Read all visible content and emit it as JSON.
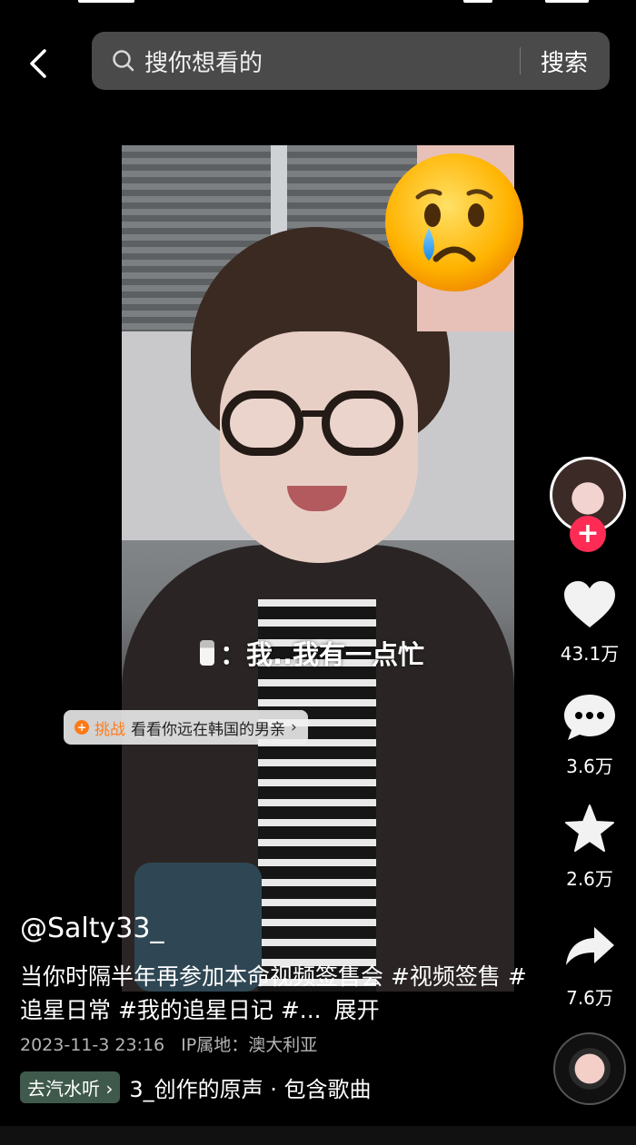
{
  "search": {
    "placeholder": "搜你想看的",
    "button": "搜索"
  },
  "video": {
    "caption": "：我..我有一点忙",
    "challenge_tag": "挑战",
    "challenge_text": "看看你远在韩国的男亲",
    "emoji": "crying-face"
  },
  "actions": {
    "likes": "43.1万",
    "comments": "3.6万",
    "favorites": "2.6万",
    "shares": "7.6万"
  },
  "post": {
    "author": "@Salty33_",
    "description": "当你时隔半年再参加本命视频签售会 #视频签售 #追星日常 #我的追星日记 #...",
    "expand": "展开",
    "date": "2023-11-3 23:16",
    "ip_location": "IP属地：澳大利亚",
    "music_pill": "去汽水听 ›",
    "music_track": "3_创作的原声 · 包含歌曲"
  },
  "colors": {
    "accent": "#fe2c55",
    "challenge": "#ff7a1a",
    "music_pill": "#3f5a4c"
  }
}
